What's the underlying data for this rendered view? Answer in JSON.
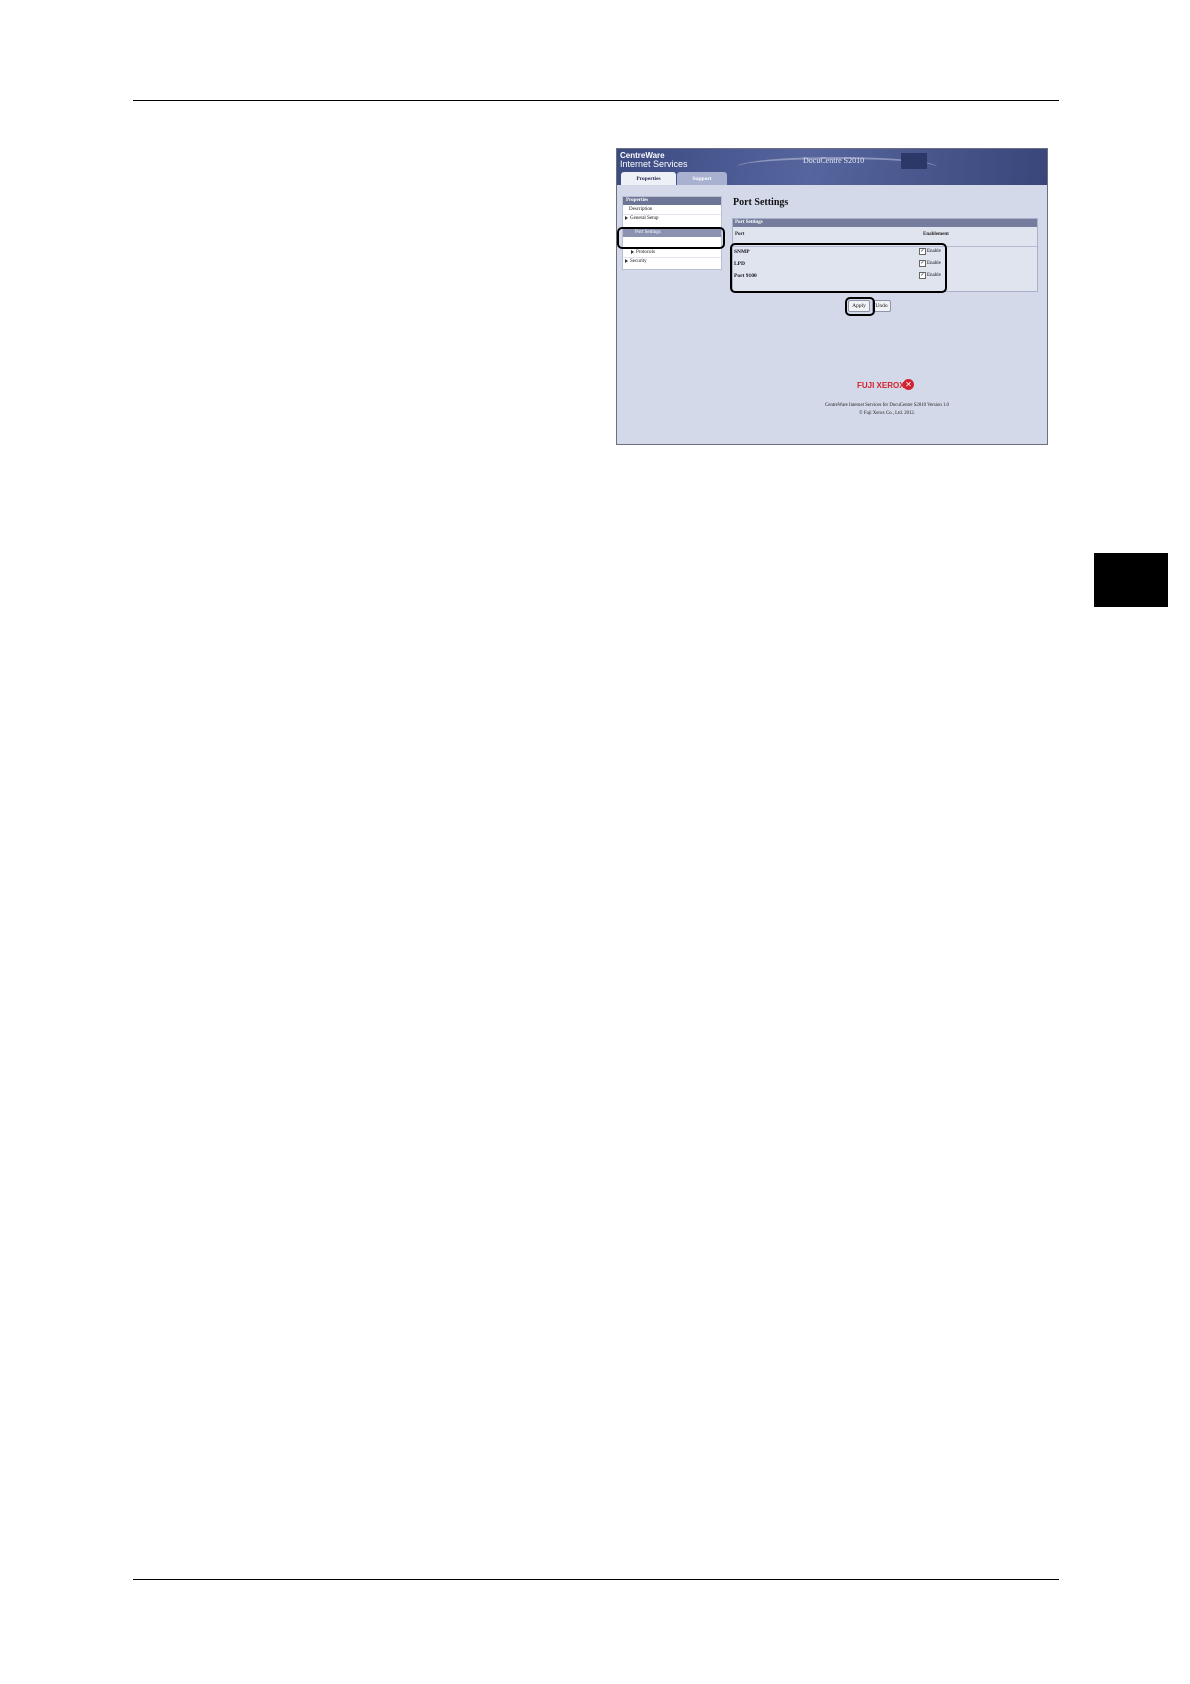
{
  "app": {
    "brand_line1": "CentreWare",
    "brand_line2": "Internet Services",
    "model": "DocuCentre S2010"
  },
  "tabs": [
    {
      "label": "Properties",
      "active": true
    },
    {
      "label": "Support",
      "active": false
    }
  ],
  "sidebar": {
    "header": "Properties",
    "items": [
      {
        "label": "Description"
      },
      {
        "label": "General Setup",
        "expandable": true
      },
      {
        "label": "Port Settings",
        "selected": true
      },
      {
        "label": "Protocols",
        "expandable": true
      },
      {
        "label": "Security",
        "expandable": true
      }
    ]
  },
  "main": {
    "title": "Port Settings",
    "panel_title": "Port Settings",
    "col_port": "Port",
    "col_enablement": "Enablement",
    "rows": [
      {
        "port": "SNMP",
        "checked": true,
        "enable_label": "Enable"
      },
      {
        "port": "LPD",
        "checked": true,
        "enable_label": "Enable"
      },
      {
        "port": "Port 9100",
        "checked": true,
        "enable_label": "Enable"
      }
    ],
    "apply_label": "Apply",
    "undo_label": "Undo"
  },
  "footer": {
    "logo_text": "FUJI XEROX",
    "line1": "CentreWare Internet Services for DocuCentre S2010 Version 1.0",
    "line2": "© Fuji Xerox Co., Ltd. 2012."
  },
  "colors": {
    "banner": "#3c4a82",
    "panel_header": "#747d9e",
    "logo_red": "#d4202f",
    "highlight": "#000000"
  }
}
